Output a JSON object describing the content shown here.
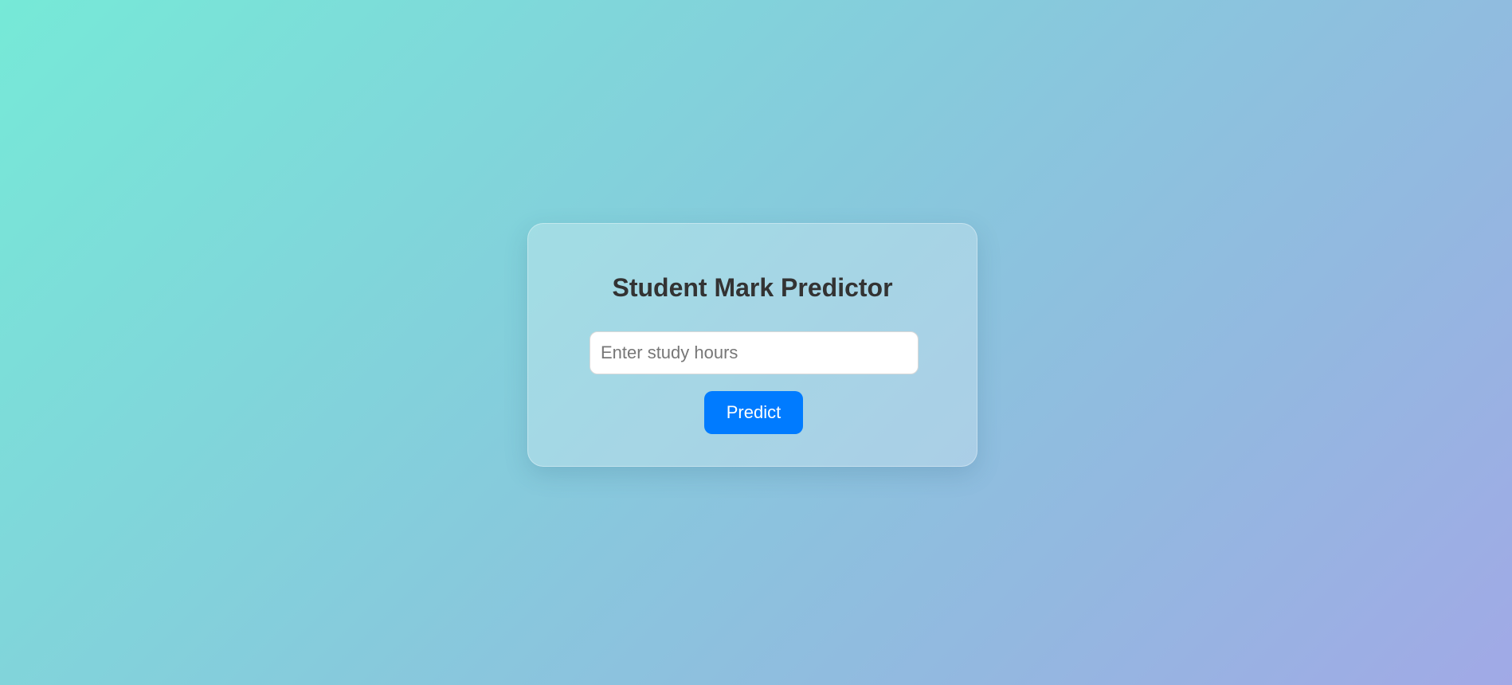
{
  "card": {
    "title": "Student Mark Predictor",
    "hours_input": {
      "placeholder": "Enter study hours",
      "value": ""
    },
    "predict_button_label": "Predict"
  },
  "colors": {
    "button": "#007bff",
    "title": "#333333",
    "gradient_start": "#76e9d7",
    "gradient_end": "#a1a9e6"
  }
}
